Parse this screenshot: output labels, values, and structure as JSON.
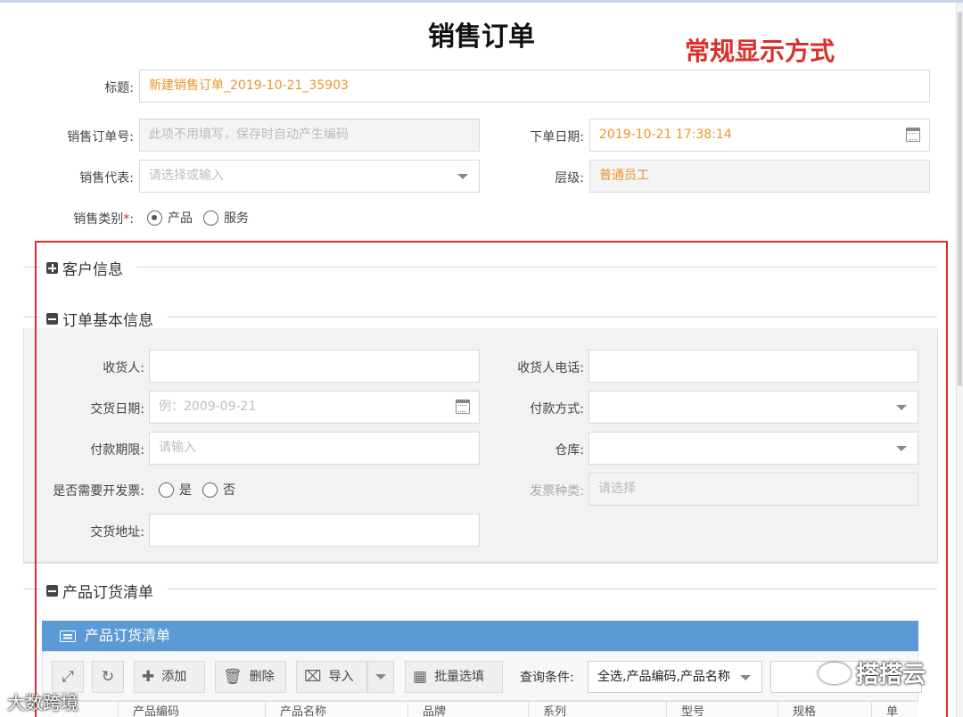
{
  "page": {
    "title": "销售订单",
    "annotation": "常规显示方式"
  },
  "header_fields": {
    "title_label": "标题:",
    "title_value": "新建销售订单_2019-10-21_35903",
    "order_no_label": "销售订单号:",
    "order_no_placeholder": "此项不用填写，保存时自动产生编码",
    "order_date_label": "下单日期:",
    "order_date_value": "2019-10-21 17:38:14",
    "sales_rep_label": "销售代表:",
    "sales_rep_placeholder": "请选择或输入",
    "level_label": "层级:",
    "level_value": "普通员工",
    "category_label": "销售类别",
    "category_required": "*",
    "category_colon": ":",
    "category_options": [
      "产品",
      "服务"
    ],
    "category_selected": "产品"
  },
  "sections": {
    "customer_info": "客户信息",
    "order_basic_info": "订单基本信息",
    "product_order_list": "产品订货清单"
  },
  "basic_info": {
    "receiver_label": "收货人:",
    "receiver_phone_label": "收货人电话:",
    "delivery_date_label": "交货日期:",
    "delivery_date_placeholder": "例：2009-09-21",
    "payment_method_label": "付款方式:",
    "payment_term_label": "付款期限:",
    "payment_term_placeholder": "请输入",
    "warehouse_label": "仓库:",
    "invoice_needed_label": "是否需要开发票:",
    "invoice_options": [
      "是",
      "否"
    ],
    "invoice_type_label": "发票种类:",
    "invoice_type_placeholder": "请选择",
    "delivery_address_label": "交货地址:"
  },
  "product_panel": {
    "title": "产品订货清单",
    "buttons": {
      "add": "添加",
      "delete": "删除",
      "import": "导入",
      "batch": "批量选填"
    },
    "query_label": "查询条件:",
    "query_value": "全选,产品编码,产品名称"
  },
  "grid_columns": [
    "产品编码",
    "产品名称",
    "品牌",
    "系列",
    "型号",
    "规格",
    "单"
  ],
  "watermarks": {
    "left": "大数跨境",
    "right": "搭搭云"
  },
  "colors": {
    "accent_red": "#d9302a",
    "value_orange": "#e8962b",
    "panel_blue": "#5b9bd5"
  }
}
